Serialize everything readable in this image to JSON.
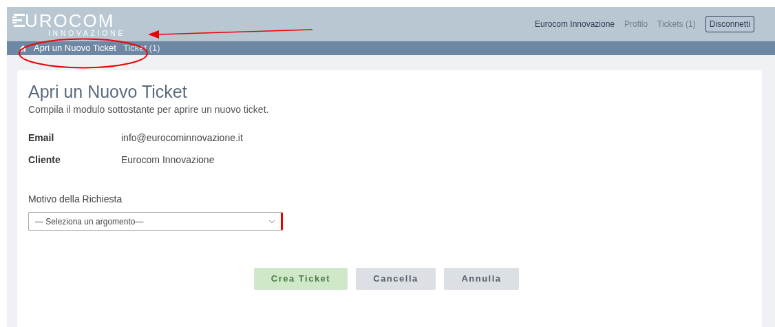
{
  "header": {
    "logo": {
      "name": "UROCOM",
      "tagline": "INNOVAZIONE"
    },
    "nav": [
      {
        "label": "Eurocom Innovazione",
        "selected": true
      },
      {
        "label": "Profilo",
        "selected": false
      },
      {
        "label": "Tickets (1)",
        "selected": false
      }
    ],
    "logout": "Disconnetti"
  },
  "breadcrumb": [
    {
      "label": "Apri un Nuovo Ticket",
      "selected": true
    },
    {
      "label": "Ticket (1)",
      "selected": false
    }
  ],
  "form": {
    "title": "Apri un Nuovo Ticket",
    "subtitle": "Compila il modulo sottostante per aprire un nuovo ticket.",
    "fields": [
      {
        "label": "Email",
        "value": "info@eurocominnovazione.it"
      },
      {
        "label": "Cliente",
        "value": "Eurocom Innovazione"
      }
    ],
    "reason": {
      "label": "Motivo della Richiesta",
      "value": "— Seleziona un argomento—",
      "required": true
    },
    "buttons": [
      {
        "label": "Crea Ticket",
        "kind": "primary"
      },
      {
        "label": "Cancella",
        "kind": "secondary"
      },
      {
        "label": "Annulla",
        "kind": "secondary"
      }
    ]
  }
}
